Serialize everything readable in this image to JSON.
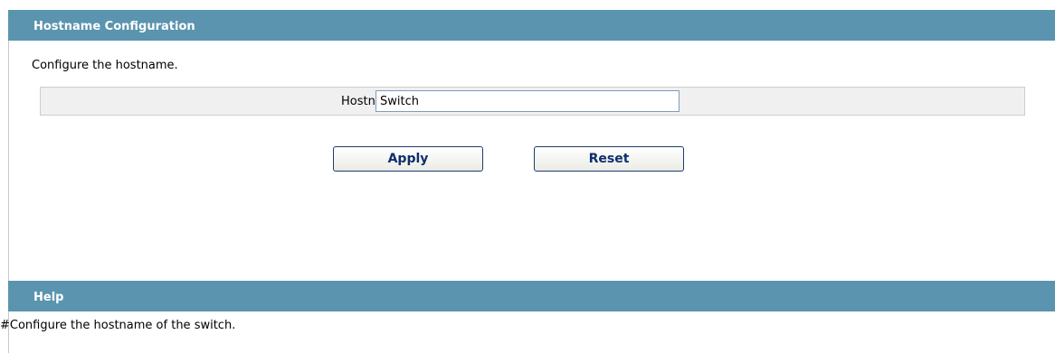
{
  "config_section": {
    "title": "Hostname Configuration",
    "description": "Configure the hostname.",
    "hostname_label": "Hostname*",
    "hostname_value": "Switch"
  },
  "buttons": {
    "apply_label": "Apply",
    "reset_label": "Reset"
  },
  "help_section": {
    "title": "Help",
    "text": "#Configure the hostname of the switch."
  }
}
